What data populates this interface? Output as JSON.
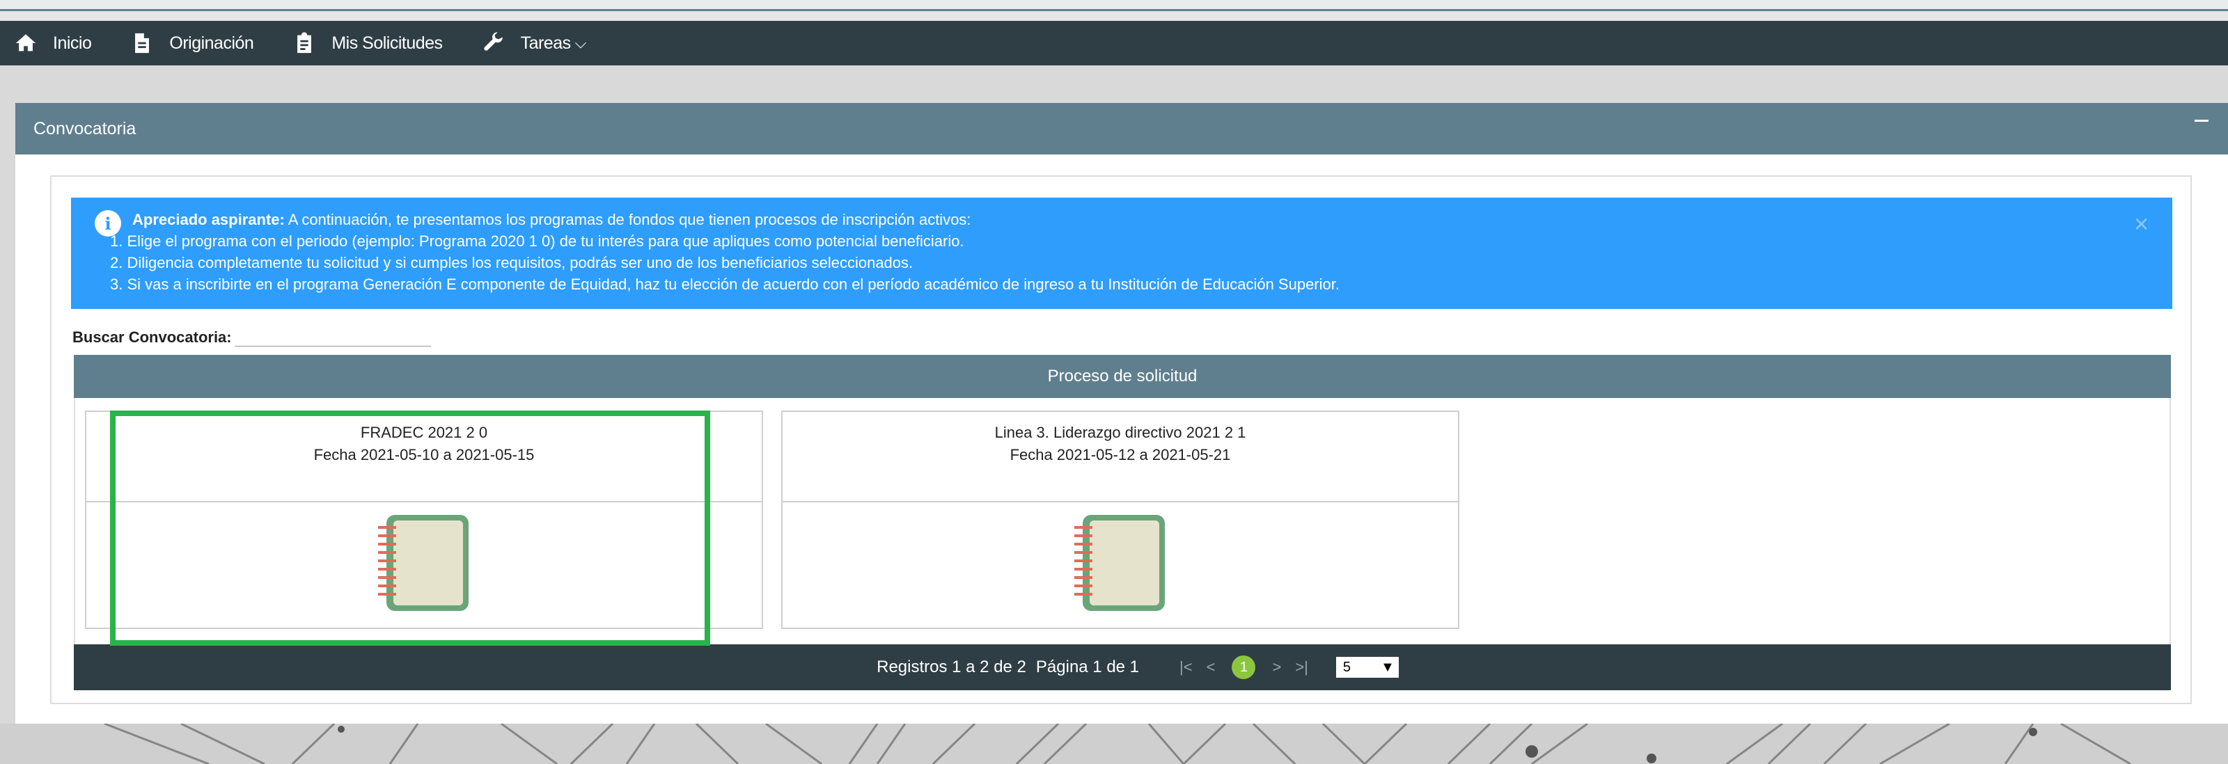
{
  "nav": {
    "items": [
      {
        "label": "Inicio",
        "icon": "home-icon"
      },
      {
        "label": "Originación",
        "icon": "document-icon"
      },
      {
        "label": "Mis Solicitudes",
        "icon": "clipboard-icon"
      },
      {
        "label": "Tareas",
        "icon": "wrench-icon"
      }
    ]
  },
  "panel": {
    "title": "Convocatoria",
    "alert": {
      "heading": "Apreciado aspirante:",
      "intro": " A continuación, te presentamos los programas de fondos que tienen procesos de inscripción activos:",
      "line1": "1. Elige el programa con el periodo (ejemplo: Programa 2020 1 0) de tu interés para que apliques como potencial beneficiario.",
      "line2": "2. Diligencia completamente tu solicitud y si cumples los requisitos, podrás ser uno de los beneficiarios seleccionados.",
      "line3": "3. Si vas a inscribirte en el programa Generación E componente de Equidad, haz tu elección de acuerdo con el período académico de ingreso a tu Institución de Educación Superior.",
      "close": "×"
    },
    "search_label": "Buscar Convocatoria:",
    "table_title": "Proceso de solicitud",
    "cards": [
      {
        "title": "FRADEC 2021 2 0",
        "dates": "Fecha 2021-05-10 a 2021-05-15"
      },
      {
        "title": "Linea 3. Liderazgo directivo 2021 2 1",
        "dates": "Fecha 2021-05-12 a 2021-05-21"
      }
    ],
    "pagination": {
      "records": "Registros 1 a 2 de 2",
      "page": "Página 1 de 1",
      "first": "|<",
      "prev": "<",
      "current": "1",
      "next": ">",
      "last": ">|",
      "page_size": "5"
    }
  },
  "colors": {
    "navbar": "#2f3e45",
    "panel_header": "#5f7f8e",
    "alert": "#2e9dfc",
    "highlight": "#2ab34a",
    "current_page": "#8cc63f"
  }
}
